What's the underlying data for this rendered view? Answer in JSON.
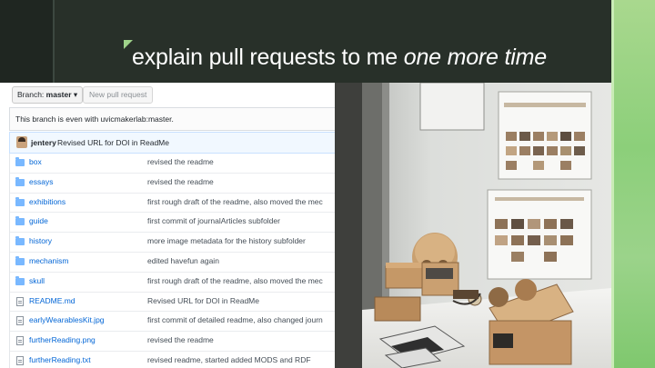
{
  "slide": {
    "title_main": "explain pull requests to me ",
    "title_em": "one more time"
  },
  "toolbar": {
    "branch_label": "Branch: ",
    "branch_name": "master",
    "branch_caret": "▾",
    "new_pr_label": "New pull request"
  },
  "status": {
    "text": "This branch is even with uvicmakerlab:master."
  },
  "commit": {
    "user": "jentery",
    "message": "Revised URL for DOI in ReadMe"
  },
  "files": [
    {
      "type": "folder",
      "name": "box",
      "message": "revised the readme"
    },
    {
      "type": "folder",
      "name": "essays",
      "message": "revised the readme"
    },
    {
      "type": "folder",
      "name": "exhibitions",
      "message": "first rough draft of the readme, also moved the mec"
    },
    {
      "type": "folder",
      "name": "guide",
      "message": "first commit of journalArticles subfolder"
    },
    {
      "type": "folder",
      "name": "history",
      "message": "more image metadata for the history subfolder"
    },
    {
      "type": "folder",
      "name": "mechanism",
      "message": "edited havefun again"
    },
    {
      "type": "folder",
      "name": "skull",
      "message": "first rough draft of the readme, also moved the mec"
    },
    {
      "type": "file",
      "name": "README.md",
      "message": "Revised URL for DOI in ReadMe"
    },
    {
      "type": "file",
      "name": "earlyWearablesKit.jpg",
      "message": "first commit of detailed readme, also changed journ"
    },
    {
      "type": "file",
      "name": "furtherReading.png",
      "message": "revised the readme"
    },
    {
      "type": "file",
      "name": "furtherReading.txt",
      "message": "revised readme, started added MODS and RDF"
    }
  ],
  "colors": {
    "accent_green": "#8ccf7a",
    "link_blue": "#0366d6",
    "slide_dark": "#283029"
  }
}
